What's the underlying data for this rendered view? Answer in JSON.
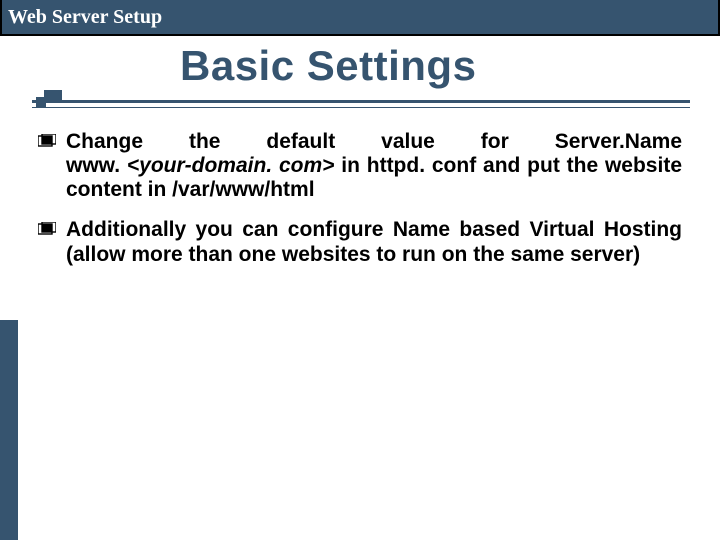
{
  "header": {
    "title": "Web Server Setup"
  },
  "title": "Basic Settings",
  "bullets": [
    {
      "line1_pre": "Change the default value for Server.",
      "line1_post": "Name",
      "rest_pre": "www. ",
      "rest_italic": "<your-domain. com>",
      "rest_post": " in httpd. conf and put the website content in /var/www/html"
    },
    {
      "text": "Additionally you can configure Name based Virtual Hosting (allow more than one websites to run on the same server)"
    }
  ]
}
